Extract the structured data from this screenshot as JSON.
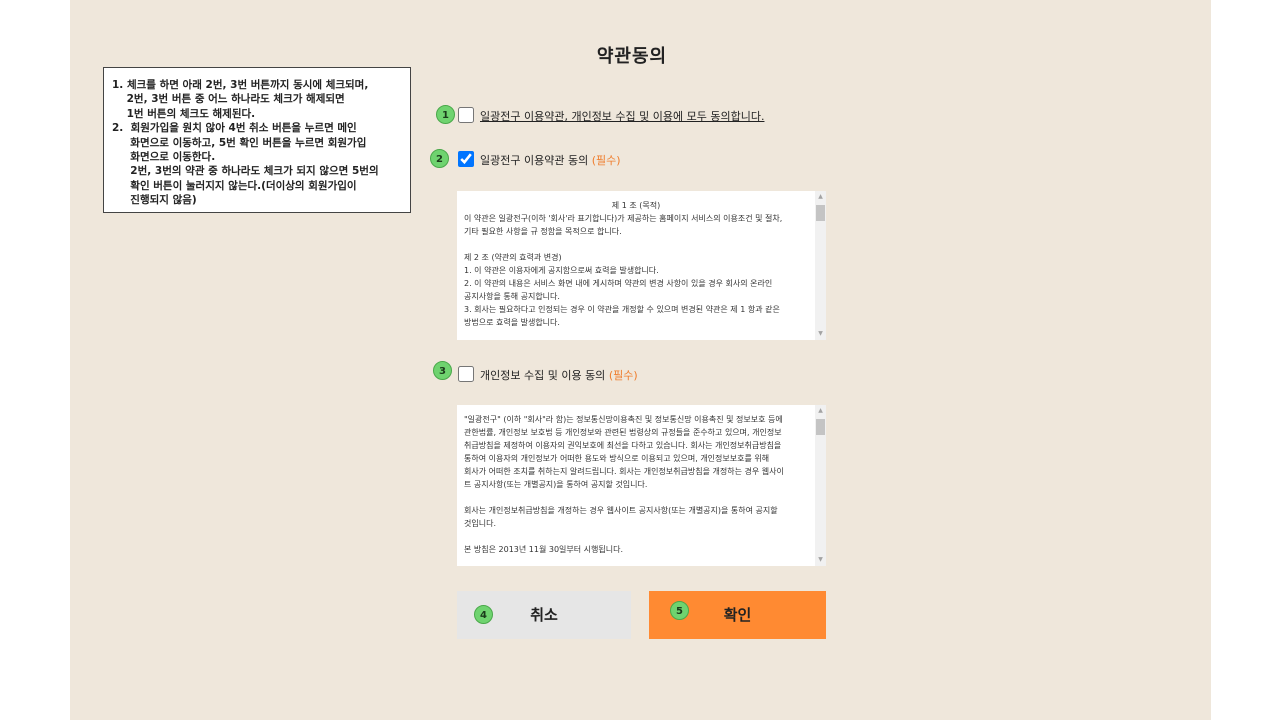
{
  "page": {
    "title": "약관동의"
  },
  "note": {
    "lines": [
      "1. 체크를 하면 아래 2번, 3번 버튼까지 동시에 체크되며,",
      "    2번, 3번 버튼 중 어느 하나라도 체크가 해제되면",
      "    1번 버튼의 체크도 해제된다.",
      "2.  회원가입을 원치 않아 4번 취소 버튼을 누르면 메인",
      "     화면으로 이동하고, 5번 확인 버튼을 누르면 회원가입",
      "     화면으로 이동한다.",
      "     2번, 3번의 약관 중 하나라도 체크가 되지 않으면 5번의",
      "     확인 버튼이 눌러지지 않는다.(더이상의 회원가입이",
      "     진행되지 않음)"
    ]
  },
  "badges": [
    "1",
    "2",
    "3",
    "4",
    "5"
  ],
  "agree_all": {
    "label": "일광전구 이용약관, 개인정보 수집 및 이용에 모두 동의합니다.",
    "checked": false
  },
  "terms": {
    "label": "일광전구 이용약관 동의 ",
    "required": "(필수)",
    "checked": true,
    "heading": "제 1 조 (목적)",
    "body": "이 약관은 일광전구(이하 '회사'라 표기합니다)가 제공하는 홈페이지 서비스의 이용조건 및 절차,\n기타 필요한 사항을 규 정함을 목적으로 합니다.\n\n제 2 조 (약관의 효력과 변경)\n1. 이 약관은 이용자에게 공지함으로써 효력을 발생합니다.\n2. 이 약관의 내용은 서비스 화면 내에 게시하며 약관의 변경 사항이 있을 경우 회사의 온라인\n공지사항을 통해 공지합니다.\n3. 회사는 필요하다고 인정되는 경우 이 약관을 개정할 수 있으며 변경된 약관은 제 1 항과 같은\n방법으로 효력을 발생합니다."
  },
  "privacy": {
    "label": "개인정보 수집 및 이용 동의 ",
    "required": "(필수)",
    "checked": false,
    "body": "\"일광전구\" (이하 \"회사\"라 함)는 정보통신망이용촉진 및 정보통신망 이용촉진 및 정보보호 등에\n관한법률, 개인정보 보호법 등 개인정보와 관련된 법령상의 규정들을 준수하고 있으며, 개인정보\n취급방침을 제정하여 이용자의 권익보호에 최선을 다하고 있습니다. 회사는 개인정보취급방침을\n통하여 이용자의 개인정보가 어떠한 용도와 방식으로 이용되고 있으며, 개인정보보호를 위해\n회사가 어떠한 조치를 취하는지 알려드립니다. 회사는 개인정보취급방침을 개정하는 경우 웹사이\n트 공지사항(또는 개별공지)을 통하여 공지할 것입니다.\n\n회사는 개인정보취급방침을 개정하는 경우 웹사이트 공지사항(또는 개별공지)을 통하여 공지할\n것입니다.\n\n본 방침은 2013년 11월 30일부터 시행됩니다."
  },
  "buttons": {
    "cancel": "취소",
    "confirm": "확인"
  },
  "colors": {
    "background": "#efe7db",
    "badge": "#6fd36f",
    "required": "#ef7d2c",
    "confirm": "#ff8a32",
    "cancel": "#e6e6e6"
  }
}
